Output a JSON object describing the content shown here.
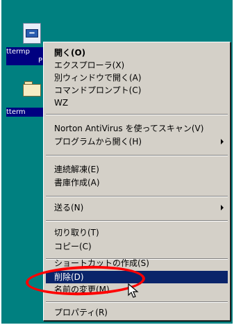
{
  "desktop": {
    "icons": [
      {
        "label_line1": "ttermp",
        "label_line2": "P",
        "icon": "text-file-icon"
      },
      {
        "label": "tterm",
        "icon": "folder-icon"
      }
    ]
  },
  "context_menu": {
    "items": [
      {
        "label": "開く(O)",
        "bold": true
      },
      {
        "label": "エクスプローラ(X)"
      },
      {
        "label": "別ウィンドウで開く(A)"
      },
      {
        "label": "コマンドプロンプト(C)"
      },
      {
        "label": "WZ"
      },
      {
        "label": "Norton AntiVirus を使ってスキャン(V)"
      },
      {
        "label": "プログラムから開く(H)",
        "submenu": true
      },
      {
        "label": "連続解凍(E)"
      },
      {
        "label": "書庫作成(A)"
      },
      {
        "label": "送る(N)",
        "submenu": true
      },
      {
        "label": "切り取り(T)"
      },
      {
        "label": "コピー(C)"
      },
      {
        "label": "ショートカットの作成(S)"
      },
      {
        "label": "削除(D)",
        "selected": true
      },
      {
        "label": "名前の変更(M)"
      },
      {
        "label": "プロパティ(R)"
      }
    ]
  },
  "colors": {
    "menu_background": "#d4d0c8",
    "selection": "#0a246a",
    "annotation": "#ff0000",
    "desktop": "#008080"
  }
}
